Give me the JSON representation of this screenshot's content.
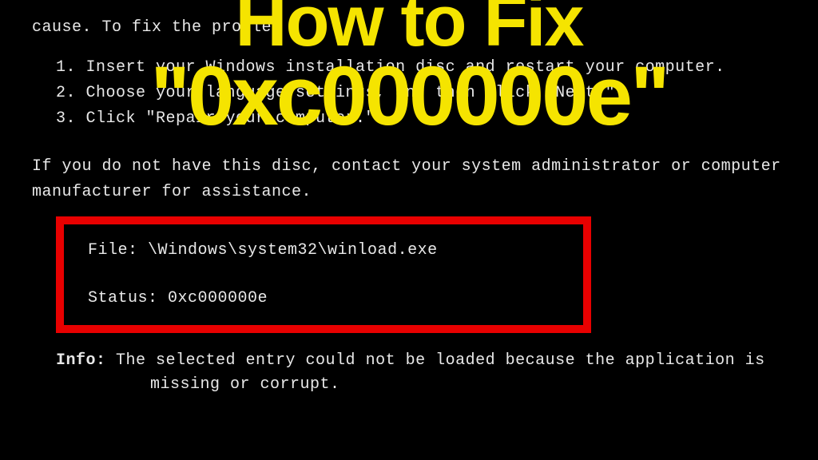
{
  "terminal": {
    "cause_line": "cause. To fix the problem",
    "step1": "1. Insert your Windows installation disc and restart your computer.",
    "step2": "2. Choose your language settings, and then click \"Next.\"",
    "step3": "3. Click \"Repair your computer.\"",
    "no_disc_line1": "If you do not have this disc, contact your system administrator or computer",
    "no_disc_line2": "manufacturer for assistance.",
    "file_label": "File: ",
    "file_value": "\\Windows\\system32\\winload.exe",
    "status_label": "Status: ",
    "status_value": "0xc000000e",
    "info_label": "Info: ",
    "info_text_1": "The selected entry could not be loaded because the application is",
    "info_text_2": "missing or corrupt."
  },
  "overlay": {
    "title_line1": "How to Fix",
    "title_line2": "\"0xc000000e\""
  }
}
